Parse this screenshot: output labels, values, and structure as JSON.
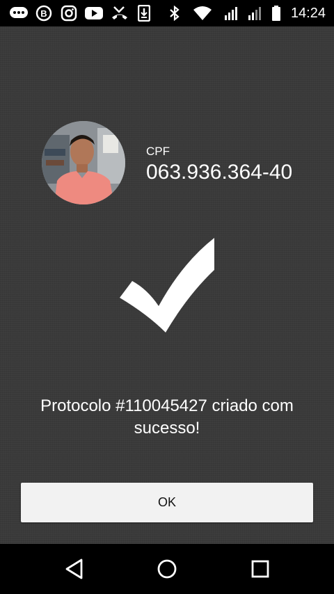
{
  "status_bar": {
    "time": "14:24",
    "icons": [
      "chat-icon",
      "b-app-icon",
      "instagram-icon",
      "youtube-icon",
      "missed-call-icon",
      "download-icon",
      "bluetooth-icon",
      "wifi-icon",
      "signal-icon",
      "signal-weak-icon",
      "battery-icon"
    ]
  },
  "profile": {
    "cpf_label": "CPF",
    "cpf_value": "063.936.364-40"
  },
  "success_icon": "checkmark-icon",
  "message": "Protocolo #110045427 criado com sucesso!",
  "ok_label": "OK",
  "nav_bar": {
    "icons": [
      "back-icon",
      "home-icon",
      "recents-icon"
    ]
  },
  "colors": {
    "background": "#3a3a3a",
    "button": "#f2f2f2",
    "text": "#ffffff"
  }
}
